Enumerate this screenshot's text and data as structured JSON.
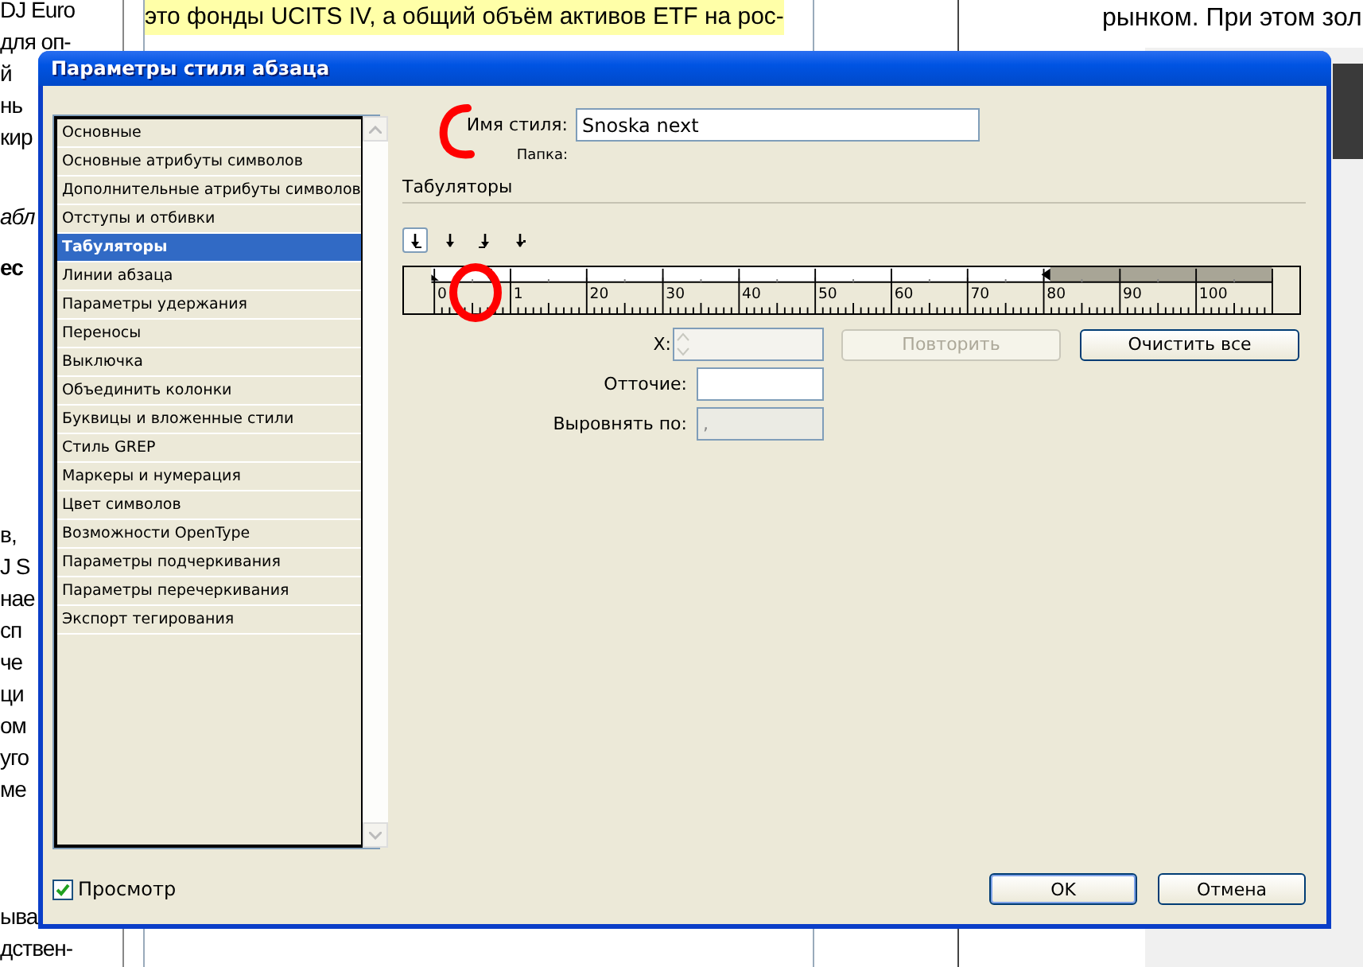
{
  "document": {
    "left_groups": [
      {
        "kind": "plain",
        "lines": [
          "DJ Euro",
          "для оп-",
          "й",
          "нь",
          "кир"
        ]
      },
      {
        "kind": "italic",
        "lines": [
          "абл"
        ]
      },
      {
        "kind": "bold",
        "lines": [
          "ес"
        ]
      },
      {
        "kind": "plain",
        "lines": [
          "в,",
          "J S",
          "нае",
          "сп",
          "че",
          "ци",
          "ом",
          "уго",
          "ме"
        ]
      },
      {
        "kind": "plain",
        "lines": [
          "ыва",
          "дствен-"
        ]
      }
    ],
    "center_lines": [
      "это фонды UCITS IV, а общий объём активов ETF на рос-"
    ],
    "right_text": "рынком. При этом зол"
  },
  "dialog": {
    "title": "Параметры стиля абзаца",
    "categories": [
      {
        "label": "Основные",
        "selected": false
      },
      {
        "label": "Основные атрибуты символов",
        "selected": false
      },
      {
        "label": "Дополнительные атрибуты символов",
        "selected": false
      },
      {
        "label": "Отступы и отбивки",
        "selected": false
      },
      {
        "label": "Табуляторы",
        "selected": true
      },
      {
        "label": "Линии абзаца",
        "selected": false
      },
      {
        "label": "Параметры удержания",
        "selected": false
      },
      {
        "label": "Переносы",
        "selected": false
      },
      {
        "label": "Выключка",
        "selected": false
      },
      {
        "label": "Объединить колонки",
        "selected": false
      },
      {
        "label": "Буквицы и вложенные стили",
        "selected": false
      },
      {
        "label": "Стиль GREP",
        "selected": false
      },
      {
        "label": "Маркеры и нумерация",
        "selected": false
      },
      {
        "label": "Цвет символов",
        "selected": false
      },
      {
        "label": "Возможности OpenType",
        "selected": false
      },
      {
        "label": "Параметры подчеркивания",
        "selected": false
      },
      {
        "label": "Параметры перечеркивания",
        "selected": false
      },
      {
        "label": "Экспорт тегирования",
        "selected": false
      }
    ],
    "style_name": {
      "label": "Имя стиля:",
      "value": "Snoska next"
    },
    "folder": {
      "label": "Папка:"
    },
    "section_title": "Табуляторы",
    "tab_types": [
      {
        "kind": "left",
        "selected": true
      },
      {
        "kind": "center",
        "selected": false
      },
      {
        "kind": "right",
        "selected": false
      },
      {
        "kind": "decimal",
        "selected": false
      }
    ],
    "ruler": {
      "labels": [
        "0",
        "1",
        "20",
        "30",
        "40",
        "50",
        "60",
        "70",
        "80",
        "90",
        "100"
      ]
    },
    "x_field": {
      "label": "X:",
      "disabled": true
    },
    "repeat_button": {
      "label": "Повторить",
      "disabled": true
    },
    "clear_button": {
      "label": "Очистить все",
      "disabled": false
    },
    "leader_field": {
      "label": "Отточие:",
      "disabled": false
    },
    "align_field": {
      "label": "Выровнять по:",
      "value": ",",
      "disabled": true
    },
    "preview": {
      "label": "Просмотр",
      "checked": true
    },
    "buttons": [
      {
        "label": "OK",
        "default": true
      },
      {
        "label": "Отмена",
        "default": false
      }
    ]
  }
}
